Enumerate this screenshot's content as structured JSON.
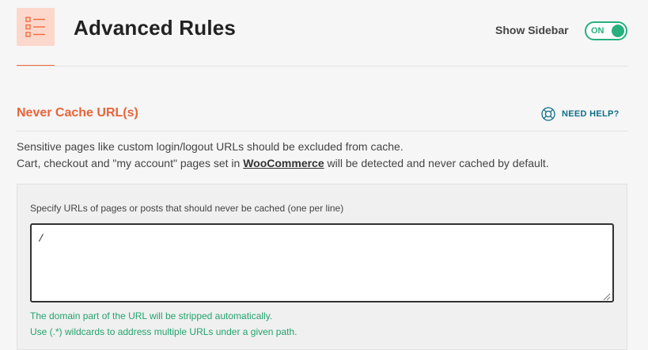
{
  "header": {
    "title": "Advanced Rules",
    "icon": "list-checklist-icon",
    "accent_color": "#f26b3f"
  },
  "sidebar_toggle": {
    "label": "Show Sidebar",
    "state": "ON",
    "color": "#27b07d"
  },
  "section": {
    "title": "Never Cache URL(s)",
    "help_label": "NEED HELP?",
    "help_icon": "lifebuoy-icon",
    "description_line1": "Sensitive pages like custom login/logout URLs should be excluded from cache.",
    "description_line2_prefix": "Cart, checkout and \"my account\" pages set in ",
    "description_link": "WooCommerce",
    "description_line2_suffix": " will be detected and never cached by default."
  },
  "urls_field": {
    "label": "Specify URLs of pages or posts that should never be cached (one per line)",
    "value": "/",
    "hint_line1": "The domain part of the URL will be stripped automatically.",
    "hint_line2": "Use (.*) wildcards to address multiple URLs under a given path."
  }
}
